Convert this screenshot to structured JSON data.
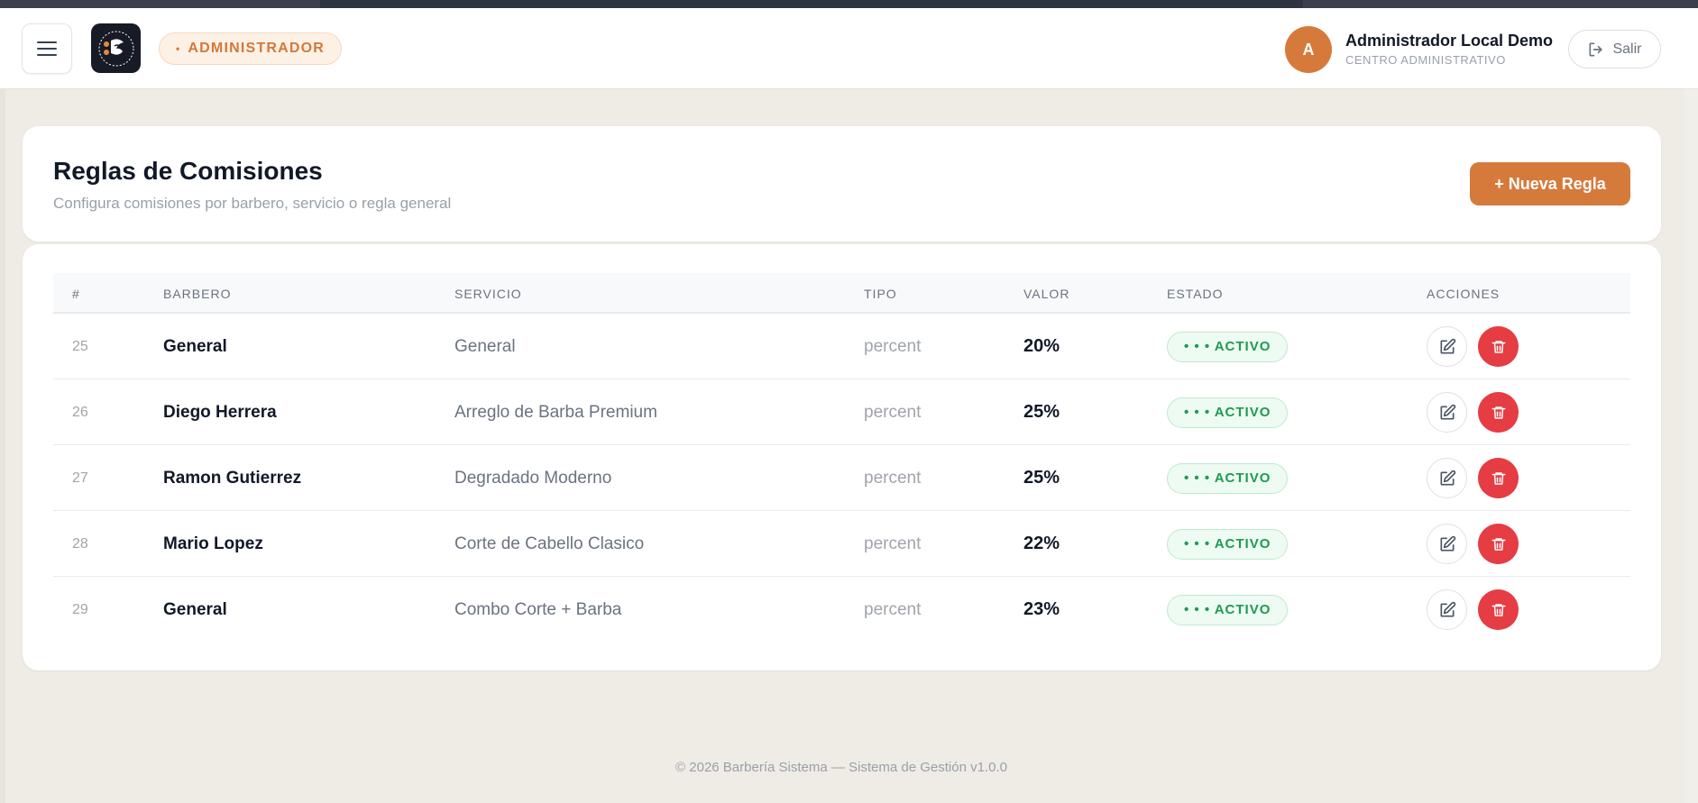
{
  "header": {
    "role_badge": "ADMINISTRADOR",
    "role_dot": "•",
    "avatar_initial": "A",
    "user_name": "Administrador Local Demo",
    "user_role": "CENTRO ADMINISTRATIVO",
    "logout_label": "Salir"
  },
  "page": {
    "title": "Reglas de Comisiones",
    "subtitle": "Configura comisiones por barbero, servicio o regla general",
    "new_rule_label": "+ Nueva Regla"
  },
  "table": {
    "columns": [
      "#",
      "BARBERO",
      "SERVICIO",
      "TIPO",
      "VALOR",
      "ESTADO",
      "ACCIONES"
    ],
    "rows": [
      {
        "id": "25",
        "barbero": "General",
        "servicio": "General",
        "tipo": "percent",
        "valor": "20%",
        "estado": "• • • ACTIVO"
      },
      {
        "id": "26",
        "barbero": "Diego Herrera",
        "servicio": "Arreglo de Barba Premium",
        "tipo": "percent",
        "valor": "25%",
        "estado": "• • • ACTIVO"
      },
      {
        "id": "27",
        "barbero": "Ramon Gutierrez",
        "servicio": "Degradado Moderno",
        "tipo": "percent",
        "valor": "25%",
        "estado": "• • • ACTIVO"
      },
      {
        "id": "28",
        "barbero": "Mario Lopez",
        "servicio": "Corte de Cabello Clasico",
        "tipo": "percent",
        "valor": "22%",
        "estado": "• • • ACTIVO"
      },
      {
        "id": "29",
        "barbero": "General",
        "servicio": "Combo Corte + Barba",
        "tipo": "percent",
        "valor": "23%",
        "estado": "• • • ACTIVO"
      }
    ]
  },
  "footer": {
    "text": "© 2026 Barbería Sistema — Sistema de Gestión v1.0.0"
  },
  "colors": {
    "accent": "#d67a3c",
    "danger": "#e63c43",
    "success": "#1f9a51",
    "background": "#efece6"
  },
  "icons": {
    "menu": "hamburger-icon",
    "logo": "barberia-logo",
    "logout": "logout-icon",
    "edit": "pencil-square-icon",
    "delete": "trash-icon"
  }
}
